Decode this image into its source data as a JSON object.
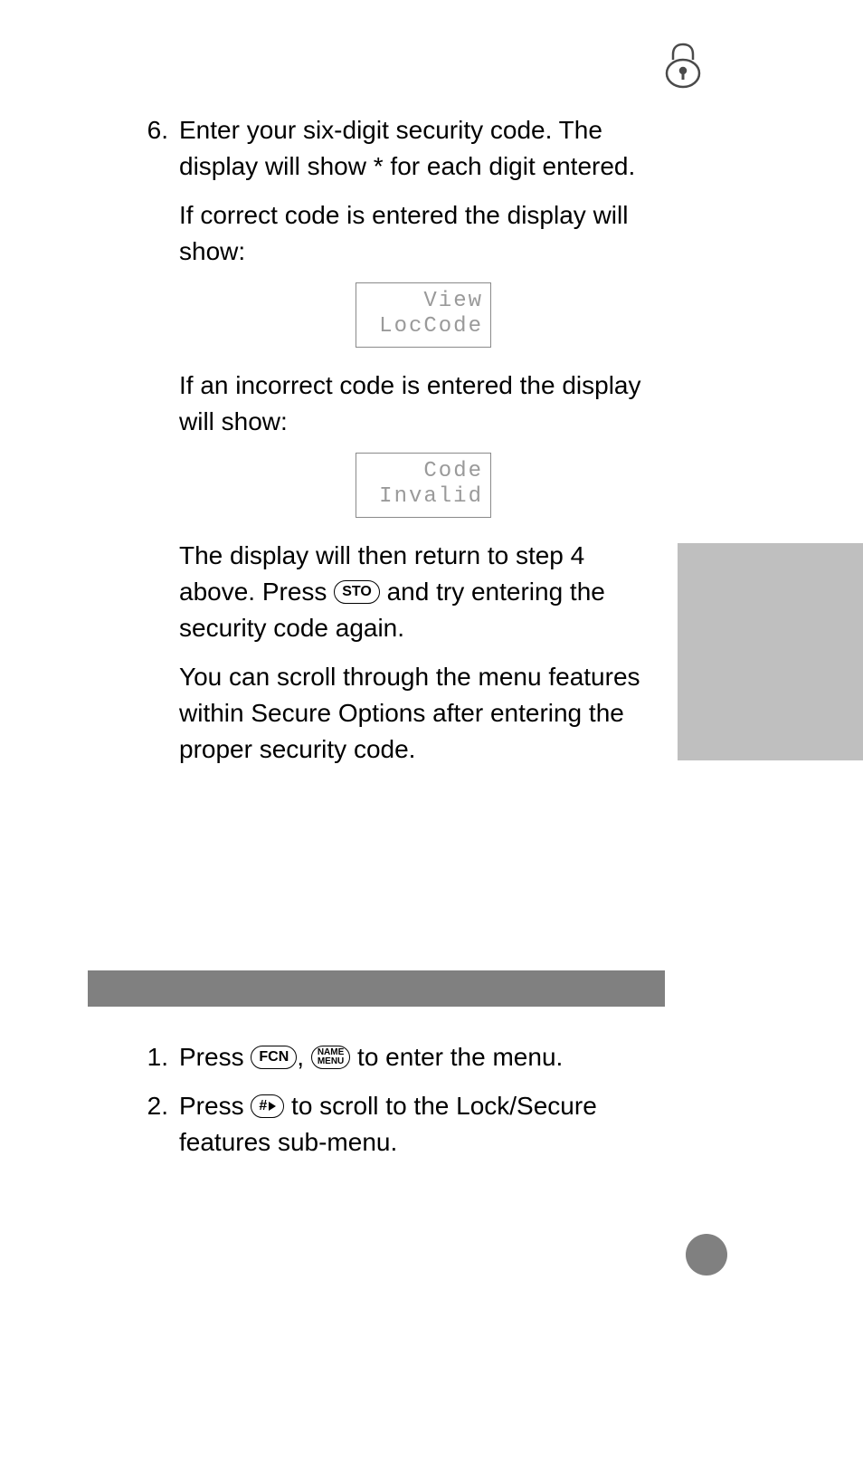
{
  "icon": {
    "name": "lock-icon"
  },
  "sectionA": {
    "item6": {
      "number": "6.",
      "text1": "Enter your six-digit security code. The display will show * for each digit entered.",
      "text2": "If correct code is entered the display will show:",
      "lcd1_line1": "View",
      "lcd1_line2": "LocCode",
      "text3": "If an incorrect code is entered the display will show:",
      "lcd2_line1": "Code",
      "lcd2_line2": "Invalid",
      "text4a": "The display will then return to step 4 above. Press ",
      "key_sto": "STO",
      "text4b": " and try entering the security code again.",
      "text5": "You can scroll through the menu features within Secure Options after entering the proper security code."
    }
  },
  "sectionB": {
    "item1": {
      "number": "1.",
      "text_a": "Press ",
      "key_fcn": "FCN",
      "text_comma": ", ",
      "key_name": "NAME",
      "key_menu": "MENU",
      "text_b": " to enter the menu."
    },
    "item2": {
      "number": "2.",
      "text_a": "Press ",
      "key_hash": "#",
      "text_b": " to scroll to the Lock/Secure features sub-menu."
    }
  }
}
